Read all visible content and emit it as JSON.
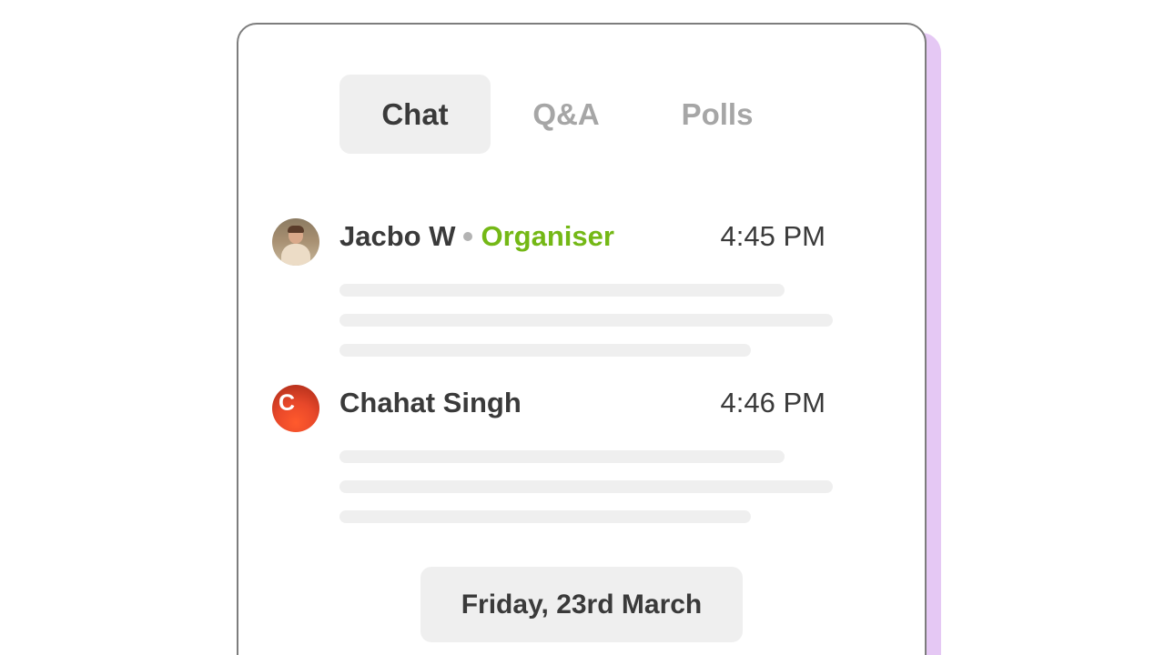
{
  "tabs": [
    {
      "label": "Chat",
      "active": true
    },
    {
      "label": "Q&A",
      "active": false
    },
    {
      "label": "Polls",
      "active": false
    }
  ],
  "messages": [
    {
      "author": "Jacbo W",
      "role": "Organiser",
      "time": "4:45 PM",
      "avatar": "photo-avatar"
    },
    {
      "author": "Chahat Singh",
      "time": "4:46 PM",
      "avatar_letter": "C"
    }
  ],
  "date_separator": "Friday, 23rd March",
  "colors": {
    "accent_shadow": "#e5c8f4",
    "organiser_role": "#74b816",
    "tab_active_bg": "#efefef",
    "avatar_letter_bg": "#e8482a"
  }
}
